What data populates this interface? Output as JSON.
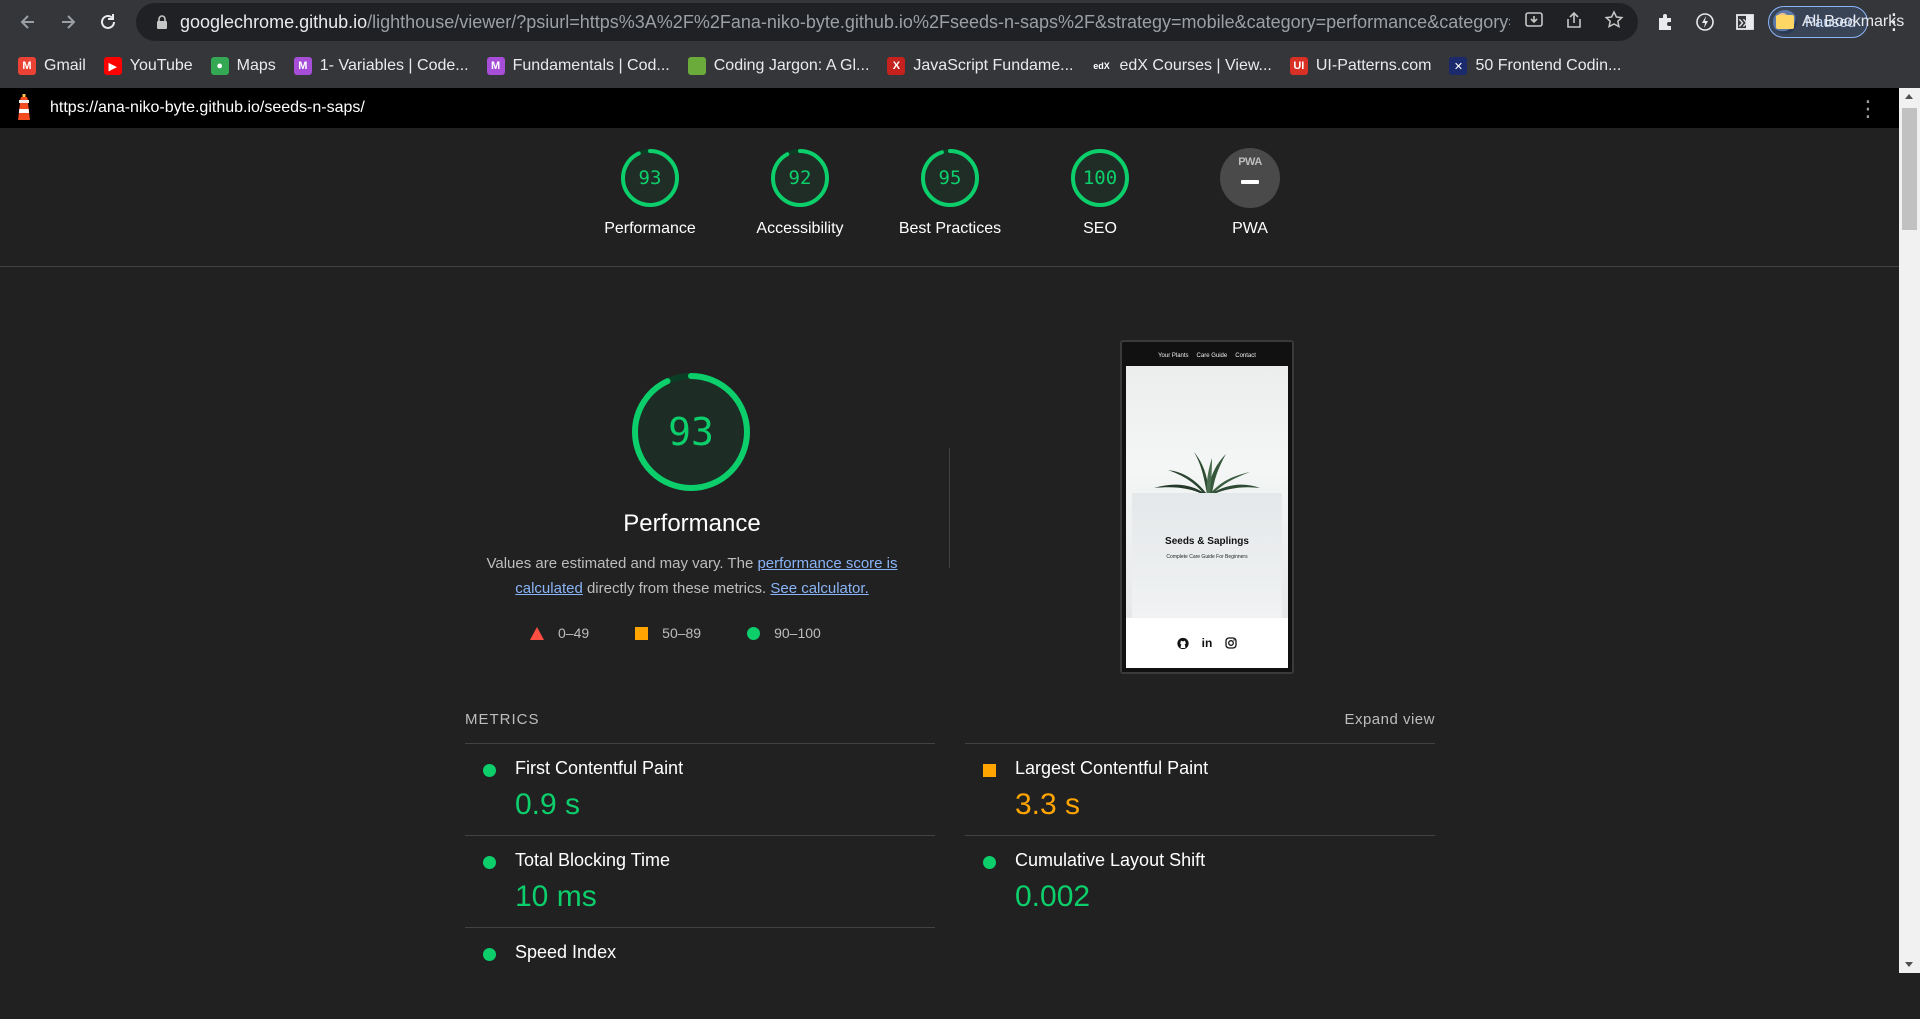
{
  "browser": {
    "url_host": "googlechrome.github.io",
    "url_rest": "/lighthouse/viewer/?psiurl=https%3A%2F%2Fana-niko-byte.github.io%2Fseeds-n-saps%2F&strategy=mobile&category=performance&category=a...",
    "profile_label": "Paused",
    "bookmarks": [
      {
        "label": "Gmail",
        "icon": "gmail-icon",
        "color": "#ea4335",
        "glyph": "M"
      },
      {
        "label": "YouTube",
        "icon": "youtube-icon",
        "color": "#ff0000",
        "glyph": "▶"
      },
      {
        "label": "Maps",
        "icon": "maps-icon",
        "color": "#34a853",
        "glyph": "●"
      },
      {
        "label": "1- Variables | Code...",
        "icon": "codecademy-icon",
        "color": "#a64ed8",
        "glyph": "M"
      },
      {
        "label": "Fundamentals | Cod...",
        "icon": "codecademy-icon",
        "color": "#a64ed8",
        "glyph": "M"
      },
      {
        "label": "Coding Jargon: A Gl...",
        "icon": "page-icon",
        "color": "#6aab3c",
        "glyph": ""
      },
      {
        "label": "JavaScript Fundame...",
        "icon": "js-icon",
        "color": "#c5221f",
        "glyph": "X"
      },
      {
        "label": "edX Courses | View...",
        "icon": "edx-icon",
        "color": "#35363a",
        "glyph": "edX"
      },
      {
        "label": "UI-Patterns.com",
        "icon": "ui-patterns-icon",
        "color": "#d93025",
        "glyph": "UI"
      },
      {
        "label": "50 Frontend Codin...",
        "icon": "x-logo-icon",
        "color": "#1a2a6c",
        "glyph": "✕"
      }
    ],
    "all_bookmarks_label": "All Bookmarks"
  },
  "lighthouse": {
    "report_url": "https://ana-niko-byte.github.io/seeds-n-saps/",
    "categories": [
      {
        "score": "93",
        "score_value": 93,
        "label": "Performance"
      },
      {
        "score": "92",
        "score_value": 92,
        "label": "Accessibility"
      },
      {
        "score": "95",
        "score_value": 95,
        "label": "Best Practices"
      },
      {
        "score": "100",
        "score_value": 100,
        "label": "SEO"
      },
      {
        "score": "",
        "label": "PWA",
        "badge_text": "PWA"
      }
    ],
    "main": {
      "score": "93",
      "score_value": 93,
      "title": "Performance",
      "desc_prefix": "Values are estimated and may vary. The ",
      "desc_link1": "performance score is calculated",
      "desc_middle": " directly from these metrics. ",
      "desc_link2": "See calculator."
    },
    "legend": [
      {
        "range": "0–49",
        "shape": "triangle",
        "color": "#ff4e42"
      },
      {
        "range": "50–89",
        "shape": "square",
        "color": "#ffa400"
      },
      {
        "range": "90–100",
        "shape": "circle",
        "color": "#0cce6b"
      }
    ],
    "screenshot": {
      "nav": [
        "Your Plants",
        "Care Guide",
        "Contact"
      ],
      "title": "Seeds & Saplings",
      "subtitle": "Complete Care Guide For Beginners"
    },
    "metrics_title": "METRICS",
    "expand_label": "Expand view",
    "metrics": [
      {
        "name": "First Contentful Paint",
        "value": "0.9 s",
        "rating": "pass"
      },
      {
        "name": "Largest Contentful Paint",
        "value": "3.3 s",
        "rating": "average"
      },
      {
        "name": "Total Blocking Time",
        "value": "10 ms",
        "rating": "pass"
      },
      {
        "name": "Cumulative Layout Shift",
        "value": "0.002",
        "rating": "pass"
      },
      {
        "name": "Speed Index",
        "value": "",
        "rating": "pass"
      }
    ]
  },
  "colors": {
    "pass": "#0cce6b",
    "average": "#ffa400",
    "fail": "#ff4e42",
    "link": "#8ab4f8"
  }
}
